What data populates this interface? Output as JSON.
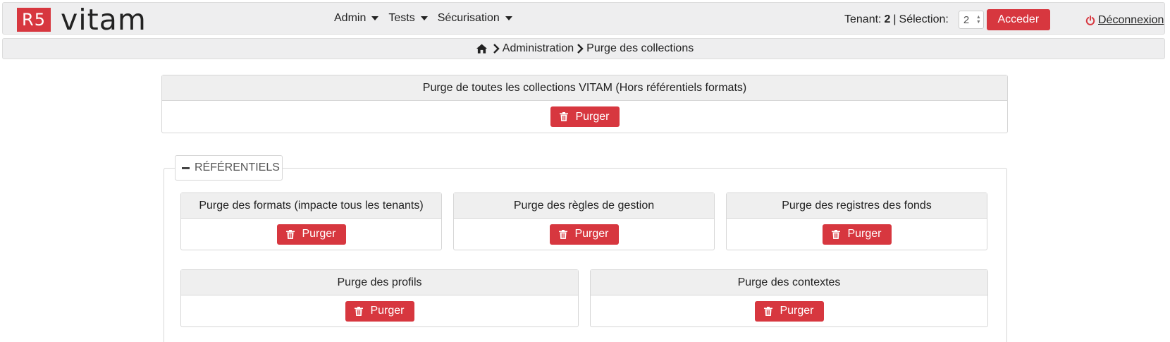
{
  "header": {
    "logo_box": "R5",
    "logo_text": "vitam",
    "menu": [
      {
        "label": "Admin"
      },
      {
        "label": "Tests"
      },
      {
        "label": "Sécurisation"
      }
    ],
    "tenant_label": "Tenant:",
    "tenant_value": "2",
    "separator": "|",
    "selection_label": "Sélection:",
    "selection_value": "2",
    "acceder_label": "Acceder",
    "logout_label": "Déconnexion"
  },
  "breadcrumb": {
    "items": [
      "Administration",
      "Purge des collections"
    ]
  },
  "main_panel": {
    "title": "Purge de toutes les collections VITAM (Hors référentiels formats)",
    "button": "Purger"
  },
  "referentiels": {
    "legend": "RÉFÉRENTIELS",
    "panels": [
      {
        "title": "Purge des formats (impacte tous les tenants)",
        "button": "Purger"
      },
      {
        "title": "Purge des règles de gestion",
        "button": "Purger"
      },
      {
        "title": "Purge des registres des fonds",
        "button": "Purger"
      },
      {
        "title": "Purge des profils",
        "button": "Purger"
      },
      {
        "title": "Purge des contextes",
        "button": "Purger"
      }
    ]
  },
  "colors": {
    "accent": "#d7373f",
    "panel_header": "#efefef",
    "navbar": "#eeeeef"
  }
}
